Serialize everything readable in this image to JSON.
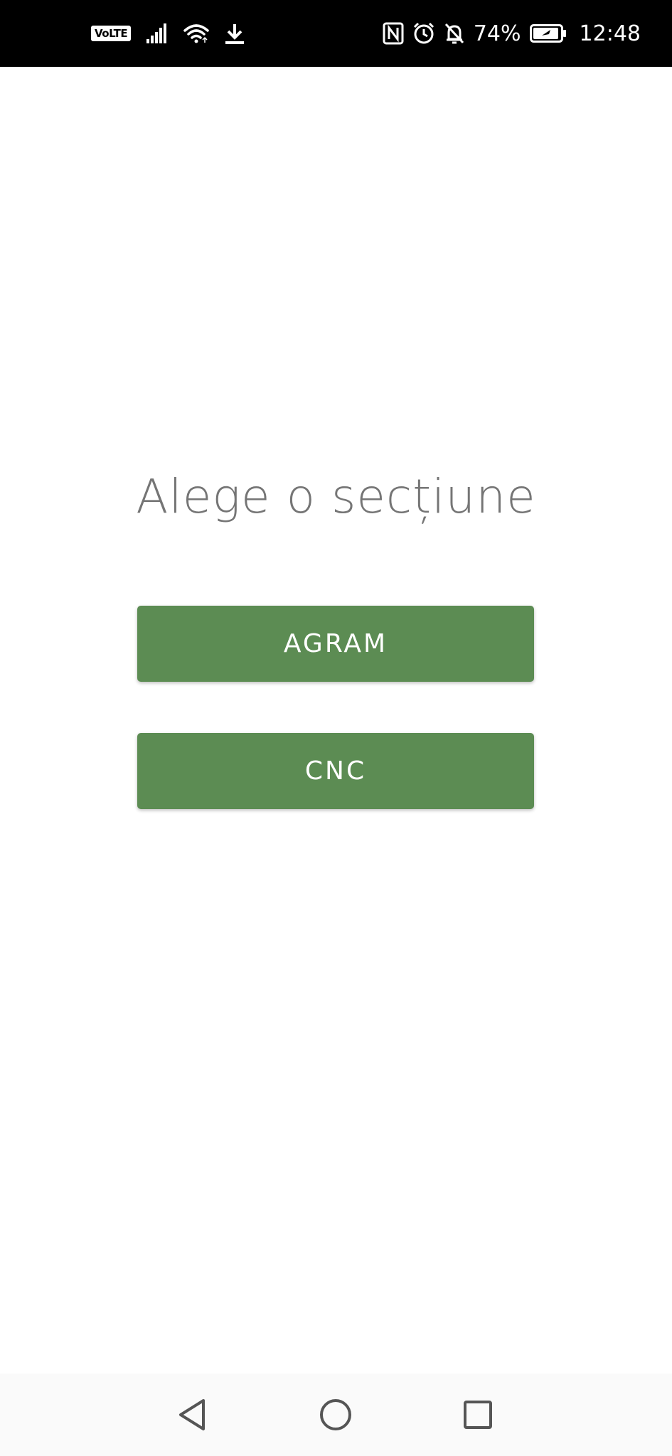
{
  "status_bar": {
    "volte": "VoLTE",
    "battery_percent": "74%",
    "time": "12:48",
    "icons": [
      "signal-icon",
      "wifi-icon",
      "download-icon",
      "nfc-icon",
      "alarm-icon",
      "notifications-off-icon",
      "battery-icon"
    ]
  },
  "main": {
    "title": "Alege o secțiune",
    "buttons": [
      {
        "label": "AGRAM"
      },
      {
        "label": "CNC"
      }
    ]
  },
  "nav_bar": {
    "icons": [
      "back-icon",
      "home-icon",
      "recents-icon"
    ]
  },
  "colors": {
    "accent": "#5c8c53",
    "title_text": "#757575",
    "status_bar_bg": "#000000"
  }
}
